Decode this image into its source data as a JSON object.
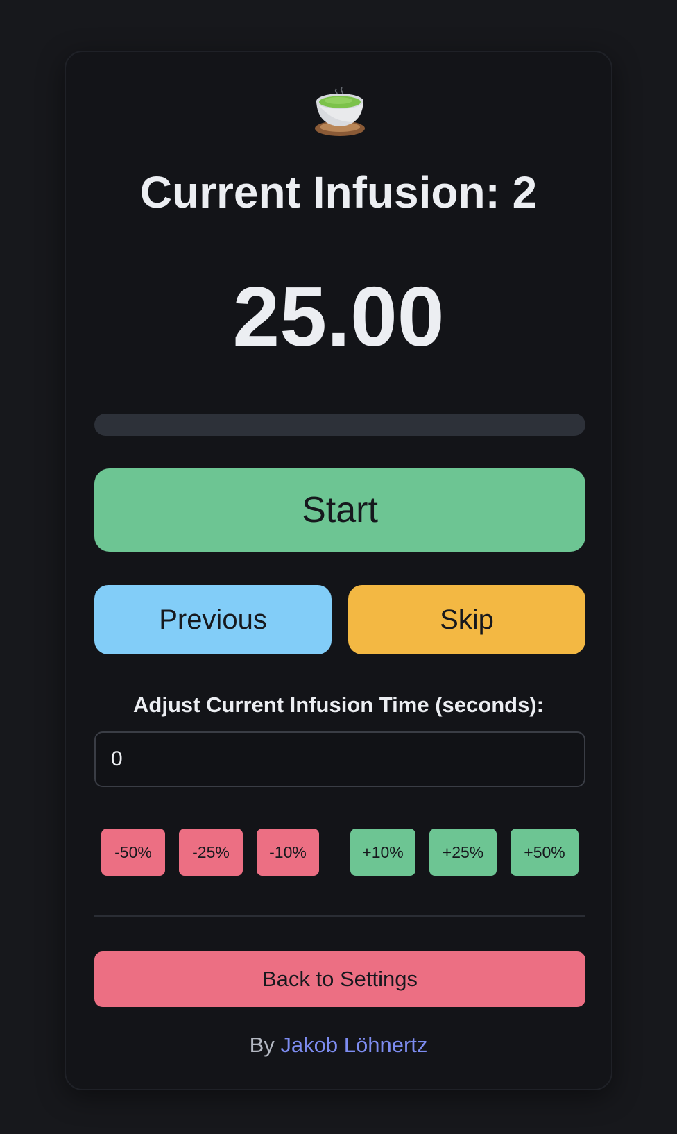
{
  "header": {
    "icon": "teacup-icon",
    "title": "Current Infusion: 2"
  },
  "timer": {
    "display": "25.00",
    "progress_percent": 0
  },
  "controls": {
    "start_label": "Start",
    "previous_label": "Previous",
    "skip_label": "Skip"
  },
  "adjust": {
    "label": "Adjust Current Infusion Time (seconds):",
    "value": "0",
    "buttons": {
      "minus50": "-50%",
      "minus25": "-25%",
      "minus10": "-10%",
      "plus10": "+10%",
      "plus25": "+25%",
      "plus50": "+50%"
    }
  },
  "back_label": "Back to Settings",
  "footer": {
    "prefix": "By",
    "author": "Jakob Löhnertz"
  },
  "colors": {
    "background": "#17181c",
    "card": "#131418",
    "green": "#6dc593",
    "blue": "#82cdf8",
    "amber": "#f3b843",
    "red": "#ec6f83",
    "link": "#7d8cf0"
  }
}
